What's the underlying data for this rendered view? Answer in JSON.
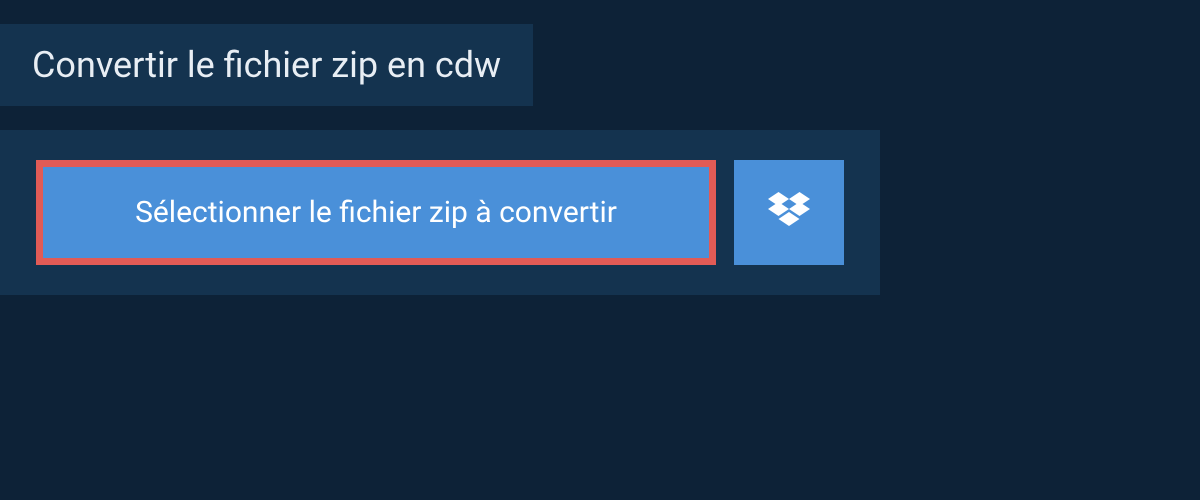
{
  "header": {
    "title": "Convertir le fichier zip en cdw"
  },
  "actions": {
    "select_file_label": "Sélectionner le fichier zip à convertir"
  },
  "colors": {
    "background": "#0d2237",
    "panel": "#14334f",
    "button": "#4a90d9",
    "highlight_border": "#e15b56",
    "text_light": "#e8eef4",
    "text_white": "#ffffff"
  }
}
